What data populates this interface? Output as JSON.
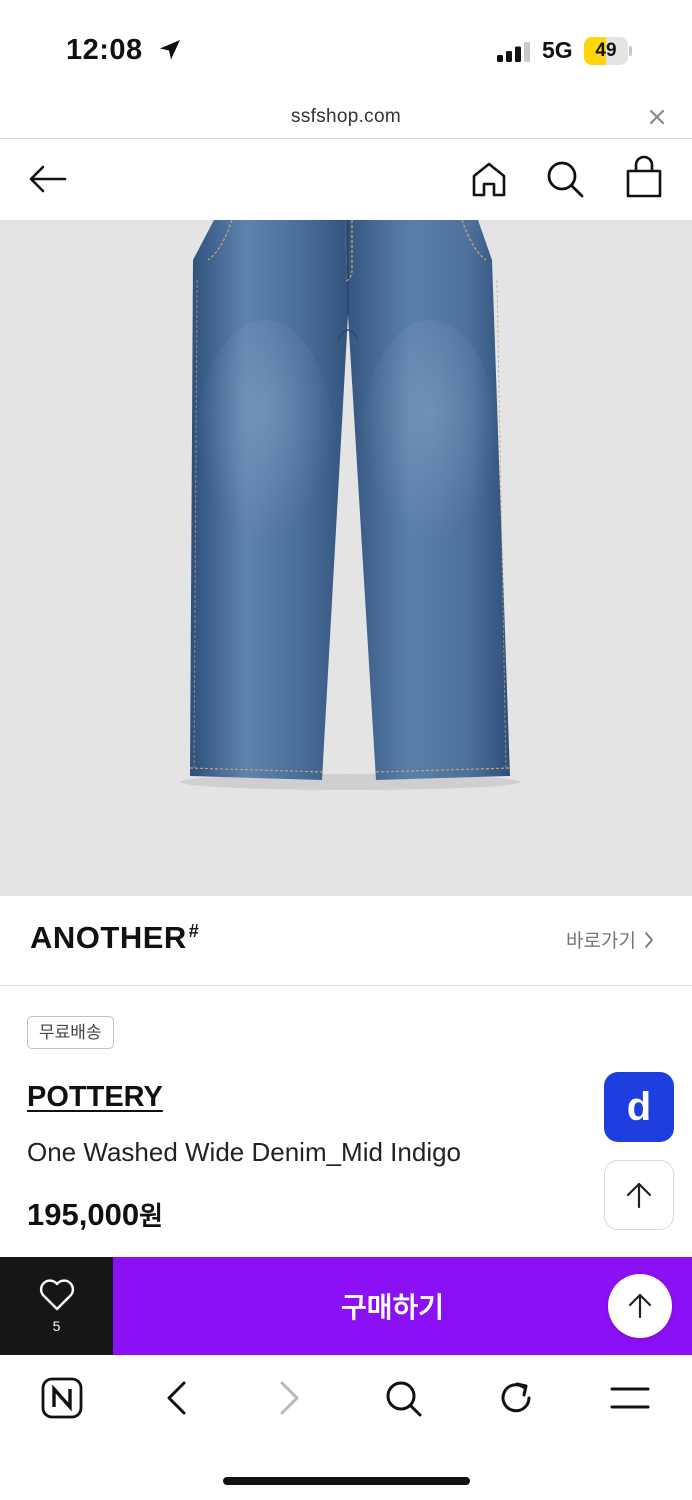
{
  "status_bar": {
    "time": "12:08",
    "network": "5G",
    "battery_level": "49",
    "battery_fraction": 0.49,
    "battery_color": "#ffd60a"
  },
  "url_bar": {
    "domain": "ssfshop.com"
  },
  "header": {
    "icons": [
      "back-arrow-icon",
      "home-icon",
      "search-icon",
      "shopping-bag-icon"
    ]
  },
  "brand": {
    "logo_text": "ANOTHER",
    "logo_mark": "#",
    "link_label": "바로가기"
  },
  "product": {
    "badge": "무료배송",
    "brand": "POTTERY",
    "name": "One Washed Wide Denim_Mid Indigo",
    "price": "195,000",
    "currency": "원"
  },
  "floating": {
    "d_label": "d",
    "d_color": "#1d3fe0"
  },
  "purchase_bar": {
    "wish_count": "5",
    "buy_label": "구매하기",
    "buy_color": "#8b10f5"
  },
  "toolbar": {
    "icons": [
      "naver-n-icon",
      "back-chevron-icon",
      "forward-chevron-icon",
      "search-icon",
      "reload-icon",
      "menu-icon"
    ]
  }
}
